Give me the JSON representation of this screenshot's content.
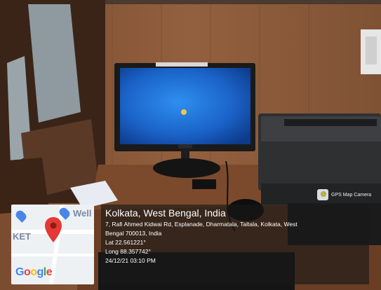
{
  "app_badge": {
    "label": "GPS Map Camera",
    "icon": "gps-map-camera-logo"
  },
  "map": {
    "brand": "Google",
    "fragments": [
      "Well",
      "KET"
    ],
    "icons": [
      "shopping-cart-pin-icon",
      "red-location-pin-icon"
    ]
  },
  "location": {
    "title": "Kolkata, West Bengal, India",
    "address_line_1": "7, Rafi Ahmed Kidwai Rd, Esplanade, Dharmatala, Taltala, Kolkata, West",
    "address_line_2": "Bengal 700013, India",
    "lat": "Lat 22.561221°",
    "long": "Long 88.357742°",
    "datetime": "24/12/21 03:10 PM"
  },
  "colors": {
    "wall_wood": "#8a5a3a",
    "screen_blue": "#1e6fd0",
    "pin_red": "#e53935"
  }
}
